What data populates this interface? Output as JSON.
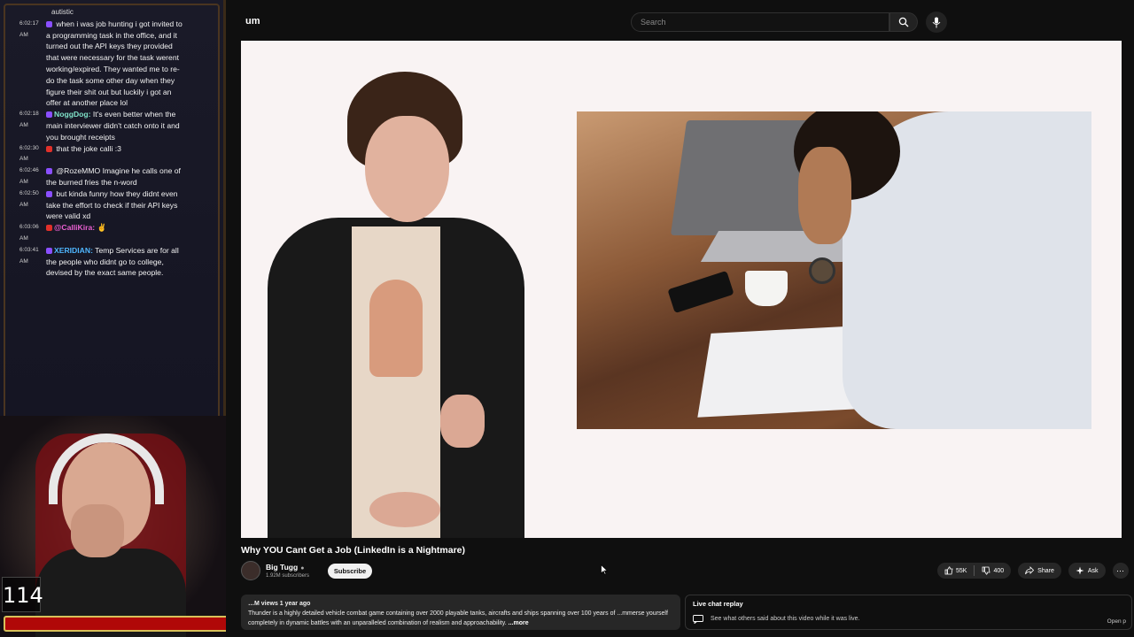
{
  "chat": {
    "top_fragment": "autistic",
    "messages": [
      {
        "time": "6:02:17 AM",
        "user": "",
        "text": "when i was job hunting i got invited to a programming task in the office, and it turned out the API keys they provided that were necessary for the task werent working/expired. They wanted me to re-do the task some other day when they figure their shit out but luckily i got an offer at another place lol",
        "badge_color": "#8a4fff",
        "user_color": "#8a4fff"
      },
      {
        "time": "6:02:18 AM",
        "user": "NoggDog:",
        "text": "It's even better when the main interviewer didn't catch onto it and you brought receipts",
        "badge_color": "#8a4fff",
        "user_color": "#7fe2c9"
      },
      {
        "time": "6:02:30 AM",
        "user": "",
        "text": "that the joke calli :3",
        "badge_color": "#e0302a",
        "user_color": "#e0302a"
      },
      {
        "time": "6:02:46 AM",
        "user": "",
        "text": "@RozeMMO Imagine he calls one of the burned fries the n-word",
        "badge_color": "#8a4fff",
        "user_color": "#e0302a"
      },
      {
        "time": "6:02:50 AM",
        "user": "",
        "text": "but kinda funny how they didnt even take the effort to check if their API keys were valid xd",
        "badge_color": "#8a4fff",
        "user_color": "#8a4fff"
      },
      {
        "time": "6:03:06 AM",
        "user": "@CalliKira:",
        "text": "",
        "badge_color": "#e0302a",
        "user_color": "#e85fd0"
      },
      {
        "time": "6:03:41 AM",
        "user": "XERIDIAN:",
        "text": "Temp Services are for all the people who didnt go to college, devised by the exact same people.",
        "badge_color": "#8a4fff",
        "user_color": "#4fb7ff"
      }
    ]
  },
  "stream_counter": "114",
  "youtube": {
    "logo_fragment": "um",
    "search_placeholder": "Search",
    "video_title": "Why YOU Cant Get a Job (LinkedIn is a Nightmare)",
    "channel_name": "Big Tugg",
    "verified_mark": "●",
    "subscriber_count": "1.92M subscribers",
    "subscribe_label": "Subscribe",
    "likes": "55K",
    "dislikes": "400",
    "share_label": "Share",
    "ask_label": "Ask",
    "more_label": "⋯",
    "description": {
      "meta": "…M views  1 year ago",
      "text": "Thunder is a highly detailed vehicle combat game containing over 2000 playable tanks, aircrafts and ships spanning over 100 years of ...mmerse yourself completely in dynamic battles with an unparalleled combination of realism and approachability.",
      "more": "...more"
    },
    "live_chat": {
      "title": "Live chat replay",
      "text": "See what others said about this video while it was live.",
      "open": "Open p"
    }
  }
}
